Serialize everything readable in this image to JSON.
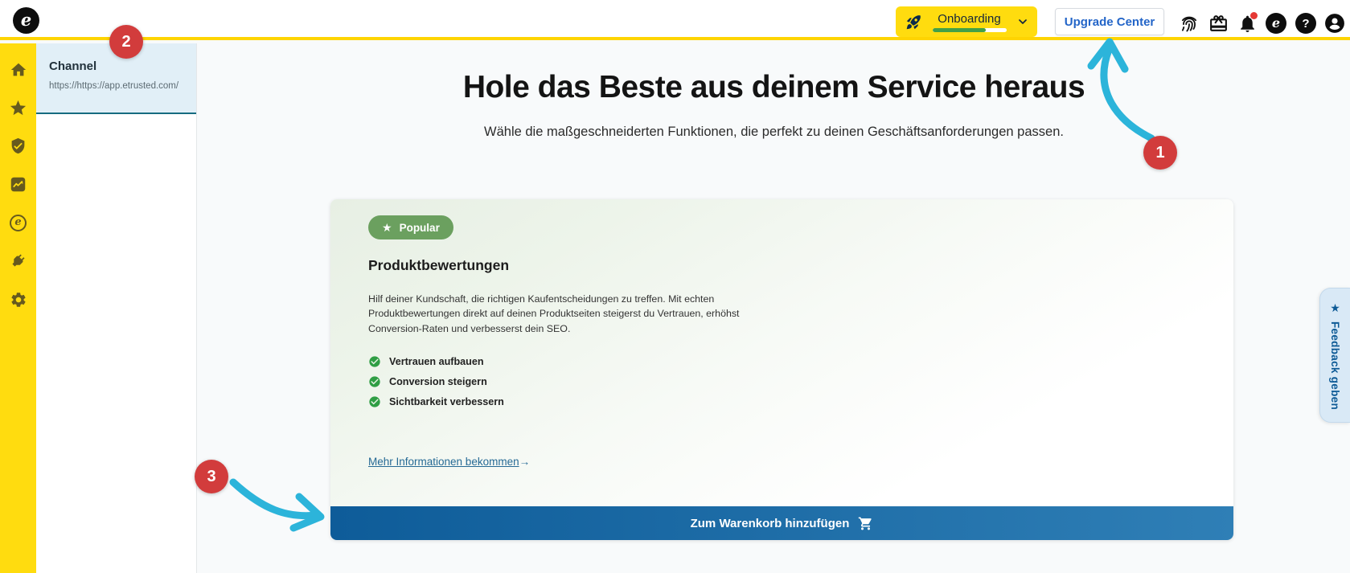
{
  "topbar": {
    "logo_letter": "e",
    "onboarding": {
      "label": "Onboarding",
      "progress_width": "72%"
    },
    "upgrade_label": "Upgrade Center"
  },
  "channel_panel": {
    "title": "Channel",
    "url": "https://https://app.etrusted.com/"
  },
  "main": {
    "title": "Hole das Beste aus deinem Service heraus",
    "subtitle": "Wähle die maßgeschneiderten Funktionen, die perfekt zu deinen Geschäftsanforderungen passen."
  },
  "card": {
    "badge_star": "★",
    "badge_label": "Popular",
    "title": "Produktbewertungen",
    "description": "Hilf deiner Kundschaft, die richtigen Kaufentscheidungen zu treffen. Mit echten Produktbewertungen direkt auf deinen Produktseiten steigerst du Vertrauen, erhöhst Conversion-Raten und verbesserst dein SEO.",
    "benefits": [
      "Vertrauen aufbauen",
      "Conversion steigern",
      "Sichtbarkeit verbessern"
    ],
    "link_label": "Mehr Informationen bekommen",
    "link_arrow": "→",
    "cta_label": "Zum Warenkorb hinzufügen"
  },
  "feedback_tab": {
    "star": "★",
    "label": "Feedback geben"
  },
  "annotations": {
    "step_1": "1",
    "step_2": "2",
    "step_3": "3"
  },
  "colors": {
    "brand_yellow": "#ffdc0f",
    "progress_green": "#43a047",
    "cta_blue_start": "#0e5c99",
    "cta_blue_end": "#2f7fb6",
    "annotation_red": "#d23c3c",
    "arrow_cyan": "#2cb4da",
    "link_blue": "#266a95",
    "badge_green": "#6ba05f",
    "channel_selected_bg": "#e1eff7"
  }
}
